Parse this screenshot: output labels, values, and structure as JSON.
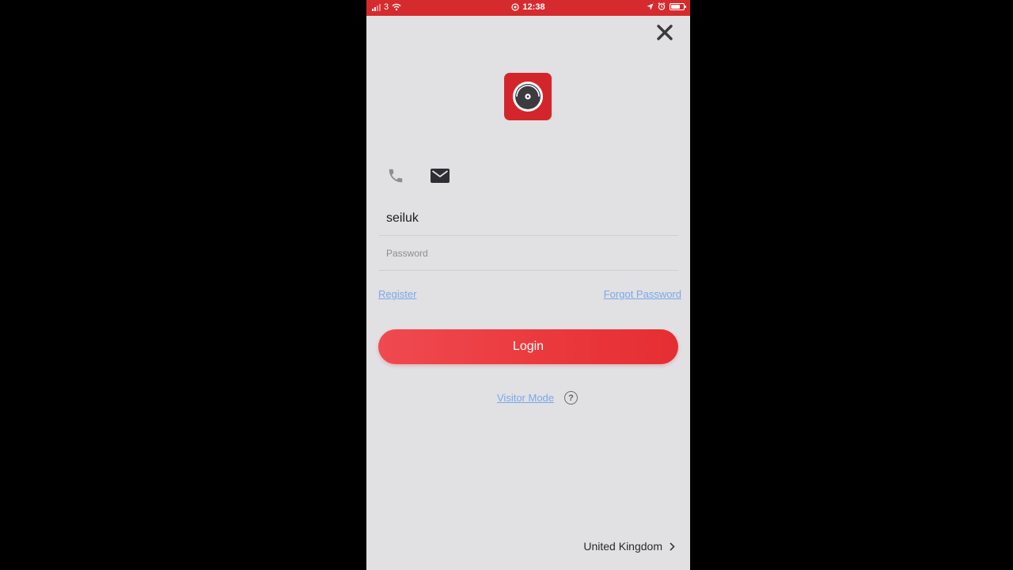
{
  "status_bar": {
    "carrier": "3",
    "time": "12:38",
    "battery_level": 0.7,
    "signal_bars": 2,
    "icons": [
      "signal-icon",
      "wifi-icon",
      "alarm-clock-icon",
      "location-arrow-icon",
      "alarm-icon",
      "battery-icon"
    ]
  },
  "close": {
    "icon": "close-icon"
  },
  "logo": {
    "icon": "app-logo-camera-lens-icon",
    "color": "#d3262c"
  },
  "login_modes": [
    {
      "icon": "phone-icon",
      "active": false
    },
    {
      "icon": "mail-icon",
      "active": true
    }
  ],
  "form": {
    "username_value": "seiluk",
    "password_placeholder": "Password"
  },
  "links": {
    "register": "Register",
    "forgot_password": "Forgot Password",
    "visitor_mode": "Visitor Mode"
  },
  "login_button": {
    "label": "Login",
    "color": "#ea383c"
  },
  "help": {
    "symbol": "?"
  },
  "region": {
    "label": "United Kingdom",
    "icon": "chevron-right-icon"
  },
  "colors": {
    "status_bar": "#d52b2f",
    "background": "#e1e0e2",
    "link": "#7aa7ec"
  }
}
